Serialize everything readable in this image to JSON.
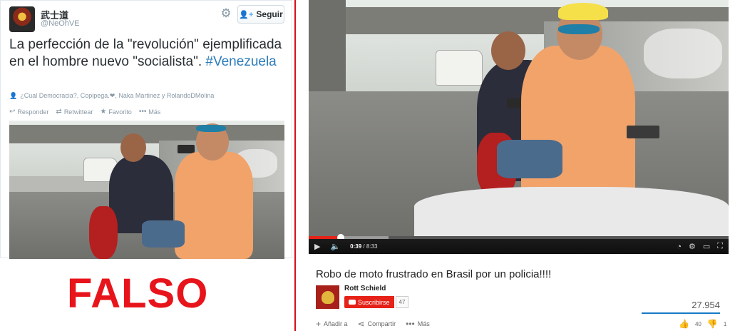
{
  "tweet": {
    "display_name": "武士道",
    "handle": "@NeOhVE",
    "follow_label": "Seguir",
    "text": "La perfección de la \"revolución\" ejemplificada en el hombre nuevo \"socialista\". ",
    "hashtag": "#Venezuela",
    "retweeters": "¿Cual Democracia?, Copipega.❤, Naka Martinez y RolandoDMolina",
    "actions": {
      "reply": "Responder",
      "retweet": "Retwittear",
      "favorite": "Favorito",
      "more": "Más"
    },
    "icons": {
      "settings": "gear-icon",
      "follow": "add-user-icon",
      "retweeters": "people-icon",
      "reply": "reply-icon",
      "retweet": "retweet-icon",
      "favorite": "star-icon",
      "more": "dots-icon"
    }
  },
  "verdict": {
    "label": "FALSO",
    "color": "#e8141b"
  },
  "divider_color": "#d90f17",
  "youtube": {
    "player": {
      "current_time": "0:39",
      "duration": "8:33",
      "played_fraction": 0.076,
      "buffered_fraction": 0.19
    },
    "title": "Robo de moto frustrado en Brasil por un policia!!!!",
    "channel": {
      "name": "Rott Schield",
      "subscribe_label": "Suscribirse",
      "subscriber_count": "47"
    },
    "views": "27.954",
    "actions": {
      "add": "Añadir a",
      "share": "Compartir",
      "more": "Más"
    },
    "likes": "40",
    "dislikes": "1",
    "colors": {
      "progress": "#e62117",
      "subscribe": "#e62117",
      "like_bar": "#167ac6"
    }
  }
}
